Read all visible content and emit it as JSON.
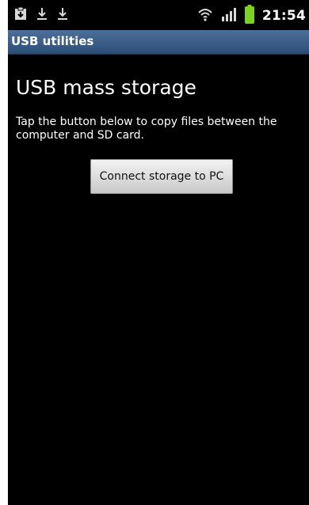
{
  "status_bar": {
    "time": "21:54",
    "icons": [
      "notification-clipboard-icon",
      "download-icon",
      "download-icon",
      "wifi-icon",
      "signal-icon",
      "battery-icon"
    ],
    "battery_color": "#7ed321"
  },
  "title_bar": {
    "title": "USB utilities"
  },
  "main": {
    "heading": "USB mass storage",
    "description": "Tap the button below to copy files between the computer and SD card.",
    "connect_button_label": "Connect storage to PC"
  }
}
